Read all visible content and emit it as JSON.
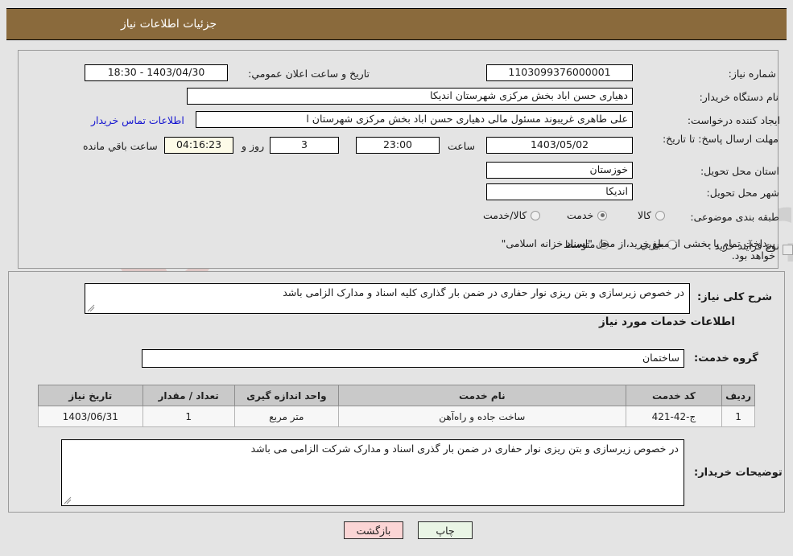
{
  "header": {
    "title": "جزئیات اطلاعات نیاز"
  },
  "top_form": {
    "need_number_label": "شماره نیاز:",
    "need_number_value": "1103099376000001",
    "announce_label": "تاریخ و ساعت اعلان عمومي:",
    "announce_value": "1403/04/30 - 18:30",
    "buyer_org_label": "نام دستگاه خریدار:",
    "buyer_org_value": "دهیاری حسن اباد بخش مرکزی شهرستان اندیکا",
    "requester_label": "ایجاد کننده درخواست:",
    "requester_value": "علی طاهری غریبوند مسئول مالی  دهیاری حسن اباد بخش مرکزی شهرستان ا",
    "contact_link": "اطلاعات تماس خریدار",
    "deadline_label": "مهلت ارسال پاسخ: تا تاریخ:",
    "deadline_date": "1403/05/02",
    "hour_label": "ساعت",
    "hour_value": "23:00",
    "days_value": "3",
    "days_label": "روز و",
    "countdown_value": "04:16:23",
    "countdown_label": "ساعت باقي مانده",
    "province_label": "استان محل تحویل:",
    "province_value": "خوزستان",
    "city_label": "شهر محل تحویل:",
    "city_value": "اندیکا",
    "category_label": "طبقه بندی موضوعی:",
    "category_options": [
      "کالا",
      "خدمت",
      "کالا/خدمت"
    ],
    "category_selected": "خدمت",
    "process_label": "نوع فرآیند خرید :",
    "process_options": [
      "جزیي",
      "متوسط"
    ],
    "process_selected": "متوسط",
    "treasury_checkbox_text": "پرداخت تمام یا بخشی از مبلغ خرید،از محل \"اسناد خزانه اسلامی\" خواهد بود.",
    "treasury_checked": false
  },
  "middle": {
    "general_desc_label": "شرح کلی نیاز:",
    "general_desc_value": "در خصوص زیرسازی و بتن ریزی نوار حفاری  در ضمن بار گذاری کلیه اسناد و مدارک الزامی باشد",
    "services_heading": "اطلاعات خدمات مورد نیاز",
    "service_group_label": "گروه خدمت:",
    "service_group_value": "ساختمان",
    "buyer_notes_label": "توضیحات خریدار:",
    "buyer_notes_value": "در خصوص زیرسازی و بتن ریزی نوار حفاری  در ضمن بار گذری اسناد و مدارک شرکت الزامی می باشد"
  },
  "table": {
    "columns": [
      "ردیف",
      "کد خدمت",
      "نام خدمت",
      "واحد اندازه گیری",
      "تعداد / مقدار",
      "تاریخ نیاز"
    ],
    "rows": [
      {
        "row": "1",
        "service_code": "ج-42-421",
        "service_name": "ساخت جاده و راه‌آهن",
        "unit": "متر مربع",
        "quantity": "1",
        "need_date": "1403/06/31"
      }
    ]
  },
  "footer": {
    "print_label": "چاپ",
    "back_label": "بازگشت"
  },
  "watermark": {
    "text": "AriaTender.net"
  },
  "colors": {
    "header_band": "#8a6a3c",
    "page_bg": "#e4e4e4",
    "link": "#1414d0",
    "table_header": "#c9c9c9",
    "print_btn": "#e9f5e5",
    "back_btn": "#fbd5d5",
    "countdown_bg": "#fdfbe8"
  }
}
